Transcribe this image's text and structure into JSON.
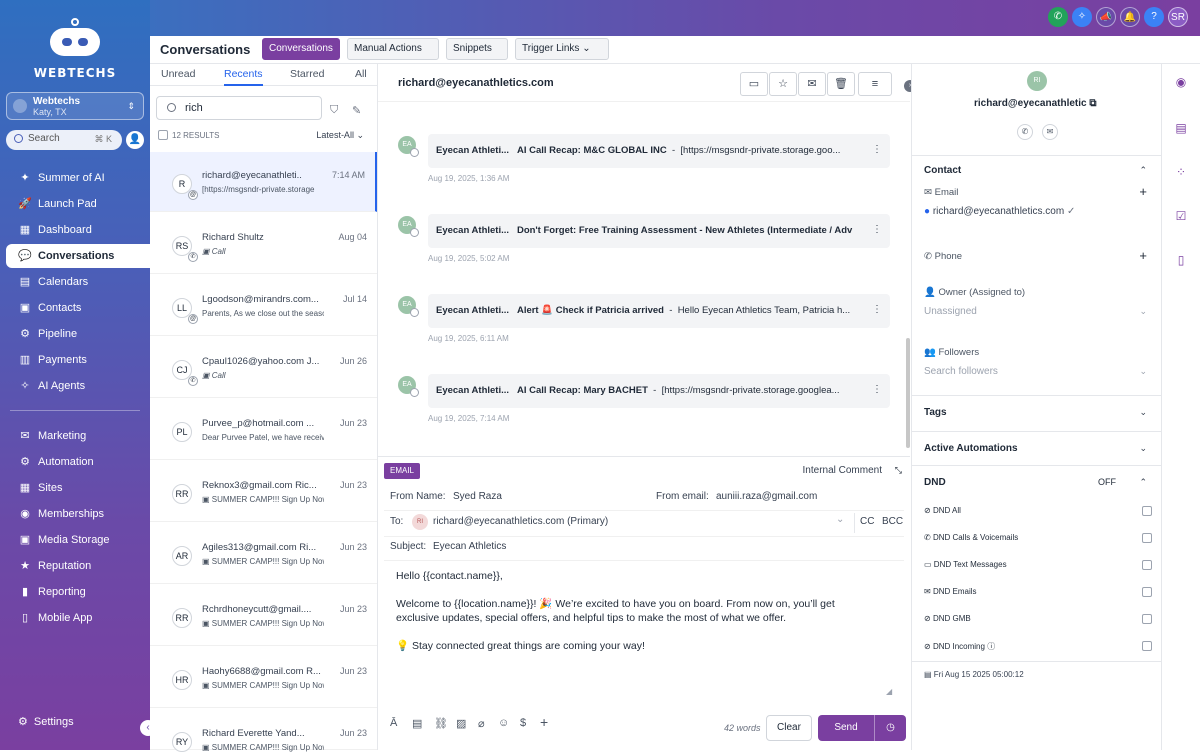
{
  "brand": {
    "name": "WEBTECHS"
  },
  "location": {
    "name": "Webtechs",
    "city": "Katy, TX"
  },
  "sidebar_search": {
    "placeholder": "Search",
    "shortcut": "⌘ K"
  },
  "nav_top": [
    {
      "label": "Summer of AI",
      "icon": "sparkle-icon"
    },
    {
      "label": "Launch Pad",
      "icon": "rocket-icon"
    },
    {
      "label": "Dashboard",
      "icon": "dashboard-icon"
    },
    {
      "label": "Conversations",
      "icon": "chat-icon",
      "active": true
    },
    {
      "label": "Calendars",
      "icon": "calendar-icon"
    },
    {
      "label": "Contacts",
      "icon": "contacts-icon"
    },
    {
      "label": "Pipeline",
      "icon": "pipeline-icon"
    },
    {
      "label": "Payments",
      "icon": "payments-icon"
    },
    {
      "label": "AI Agents",
      "icon": "ai-agents-icon"
    }
  ],
  "nav_bottom": [
    {
      "label": "Marketing",
      "icon": "marketing-icon"
    },
    {
      "label": "Automation",
      "icon": "automation-icon"
    },
    {
      "label": "Sites",
      "icon": "sites-icon"
    },
    {
      "label": "Memberships",
      "icon": "memberships-icon"
    },
    {
      "label": "Media Storage",
      "icon": "media-icon"
    },
    {
      "label": "Reputation",
      "icon": "reputation-icon"
    },
    {
      "label": "Reporting",
      "icon": "reporting-icon"
    },
    {
      "label": "Mobile App",
      "icon": "mobile-icon"
    }
  ],
  "settings_label": "Settings",
  "topbar": {
    "user_initials": "SR"
  },
  "header": {
    "title": "Conversations",
    "tabs": [
      "Conversations",
      "Manual Actions",
      "Snippets",
      "Trigger Links"
    ]
  },
  "list": {
    "tabs": [
      "Unread",
      "Recents",
      "Starred",
      "All"
    ],
    "search_value": "rich",
    "results": "12 RESULTS",
    "sort": "Latest-All",
    "rows": [
      {
        "initials": "R",
        "name": "richard@eyecanathleti..",
        "date": "7:14 AM",
        "preview": "[https://msgsndr-private.storage"
      },
      {
        "initials": "RS",
        "name": "Richard Shultz",
        "date": "Aug 04",
        "preview": "Call"
      },
      {
        "initials": "LL",
        "name": "Lgoodson@mirandrs.com...",
        "date": "Jul 14",
        "preview": "Parents, As we close out the seaso"
      },
      {
        "initials": "CJ",
        "name": "Cpaul1026@yahoo.com J...",
        "date": "Jun 26",
        "preview": "Call"
      },
      {
        "initials": "PL",
        "name": "Purvee_p@hotmail.com ...",
        "date": "Jun 23",
        "preview": "Dear Purvee Patel, we have receiv"
      },
      {
        "initials": "RR",
        "name": "Reknox3@gmail.com Ric...",
        "date": "Jun 23",
        "preview": "SUMMER CAMP!!! Sign Up Now Eyec"
      },
      {
        "initials": "AR",
        "name": "Agiles313@gmail.com Ri...",
        "date": "Jun 23",
        "preview": "SUMMER CAMP!!! Sign Up Now Eyec"
      },
      {
        "initials": "RR",
        "name": "Rchrdhoneycutt@gmail....",
        "date": "Jun 23",
        "preview": "SUMMER CAMP!!! Sign Up Now Eyec"
      },
      {
        "initials": "HR",
        "name": "Haohy6688@gmail.com R...",
        "date": "Jun 23",
        "preview": "SUMMER CAMP!!! Sign Up Now Eyec"
      },
      {
        "initials": "RY",
        "name": "Richard Everette Yand...",
        "date": "Jun 23",
        "preview": "SUMMER CAMP!!! Sign Up Now Eyec"
      }
    ]
  },
  "conversation": {
    "title": "richard@eyecanathletics.com",
    "messages": [
      {
        "initials": "EA",
        "sender": "Eyecan Athleti...",
        "subject": "AI Call Recap: M&C GLOBAL INC",
        "snippet": "[https://msgsndr-private.storage.goo...",
        "time": "Aug 19, 2025, 1:36 AM"
      },
      {
        "initials": "EA",
        "sender": "Eyecan Athleti...",
        "subject": "Don't Forget: Free Training Assessment - New Athletes (Intermediate / Adv",
        "snippet": "",
        "time": "Aug 19, 2025, 5:02 AM"
      },
      {
        "initials": "EA",
        "sender": "Eyecan Athleti...",
        "subject": "Alert 🚨 Check if Patricia arrived",
        "snippet": "Hello Eyecan Athletics Team, Patricia h...",
        "time": "Aug 19, 2025, 6:11 AM"
      },
      {
        "initials": "EA",
        "sender": "Eyecan Athleti...",
        "subject": "AI Call Recap: Mary BACHET",
        "snippet": "[https://msgsndr-private.storage.googlea...",
        "time": "Aug 19, 2025, 7:14 AM"
      }
    ]
  },
  "composer": {
    "tag": "EMAIL",
    "internal_comment": "Internal Comment",
    "from_name_label": "From Name:",
    "from_name": "Syed Raza",
    "from_email_label": "From email:",
    "from_email": "auniii.raza@gmail.com",
    "to_label": "To:",
    "to_initials": "RI",
    "to": "richard@eyecanathletics.com (Primary)",
    "cc": "CC",
    "bcc": "BCC",
    "subject_label": "Subject:",
    "subject": "Eyecan Athletics",
    "body": [
      "Hello {{contact.name}},",
      "Welcome to {{location.name}}! 🎉 We’re excited to have you on board. From now on, you’ll get exclusive updates, special offers, and helpful tips to make the most of what we offer.",
      "💡 Stay connected great things are coming your way!"
    ],
    "word_count": "42 words",
    "clear": "Clear",
    "send": "Send"
  },
  "contact": {
    "initials": "RI",
    "email_header": "richard@eyecanathletic",
    "section_contact": "Contact",
    "email_label": "Email",
    "email_value": "richard@eyecanathletics.com",
    "phone_label": "Phone",
    "owner_label": "Owner (Assigned to)",
    "owner_value": "Unassigned",
    "followers_label": "Followers",
    "followers_placeholder": "Search followers",
    "tags": "Tags",
    "automations": "Active Automations",
    "dnd": "DND",
    "dnd_state": "OFF",
    "dnd_items": [
      "DND All",
      "DND Calls & Voicemails",
      "DND Text Messages",
      "DND Emails",
      "DND GMB",
      "DND Incoming"
    ],
    "footer_date": "Fri Aug 15 2025 05:00:12"
  }
}
